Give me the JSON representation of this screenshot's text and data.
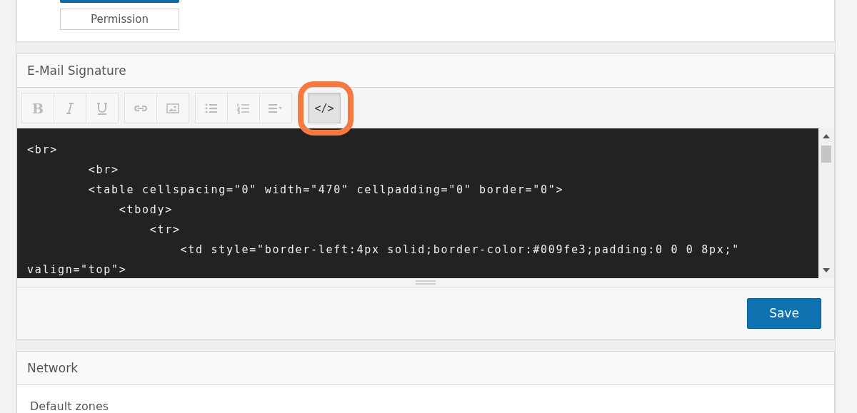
{
  "permissions_card": {
    "button": "Permission"
  },
  "signature_panel": {
    "title": "E-Mail Signature",
    "toolbar_groups": [
      {
        "buttons": [
          {
            "kind": "bold",
            "disabled": true,
            "active": false,
            "label": "B"
          },
          {
            "kind": "italic",
            "disabled": true,
            "active": false
          },
          {
            "kind": "underline",
            "disabled": true,
            "active": false
          }
        ]
      },
      {
        "buttons": [
          {
            "kind": "link",
            "disabled": true,
            "active": false
          },
          {
            "kind": "image",
            "disabled": true,
            "active": false
          }
        ]
      },
      {
        "buttons": [
          {
            "kind": "bullet-list",
            "disabled": true,
            "active": false
          },
          {
            "kind": "numbered-list",
            "disabled": true,
            "active": false
          },
          {
            "kind": "align",
            "disabled": true,
            "active": false
          }
        ]
      },
      {
        "buttons": [
          {
            "kind": "code",
            "disabled": false,
            "active": true,
            "label": "</>",
            "highlighted": true
          }
        ]
      }
    ],
    "code_lines": [
      "<br>",
      "        <br>",
      "        <table cellspacing=\"0\" width=\"470\" cellpadding=\"0\" border=\"0\">",
      "            <tbody>",
      "                <tr>",
      "                    <td style=\"border-left:4px solid;border-color:#009fe3;padding:0 0 0 8px;\"",
      "valign=\"top\">"
    ],
    "save_button": "Save"
  },
  "network_panel": {
    "title": "Network",
    "field_label": "Default zones"
  }
}
